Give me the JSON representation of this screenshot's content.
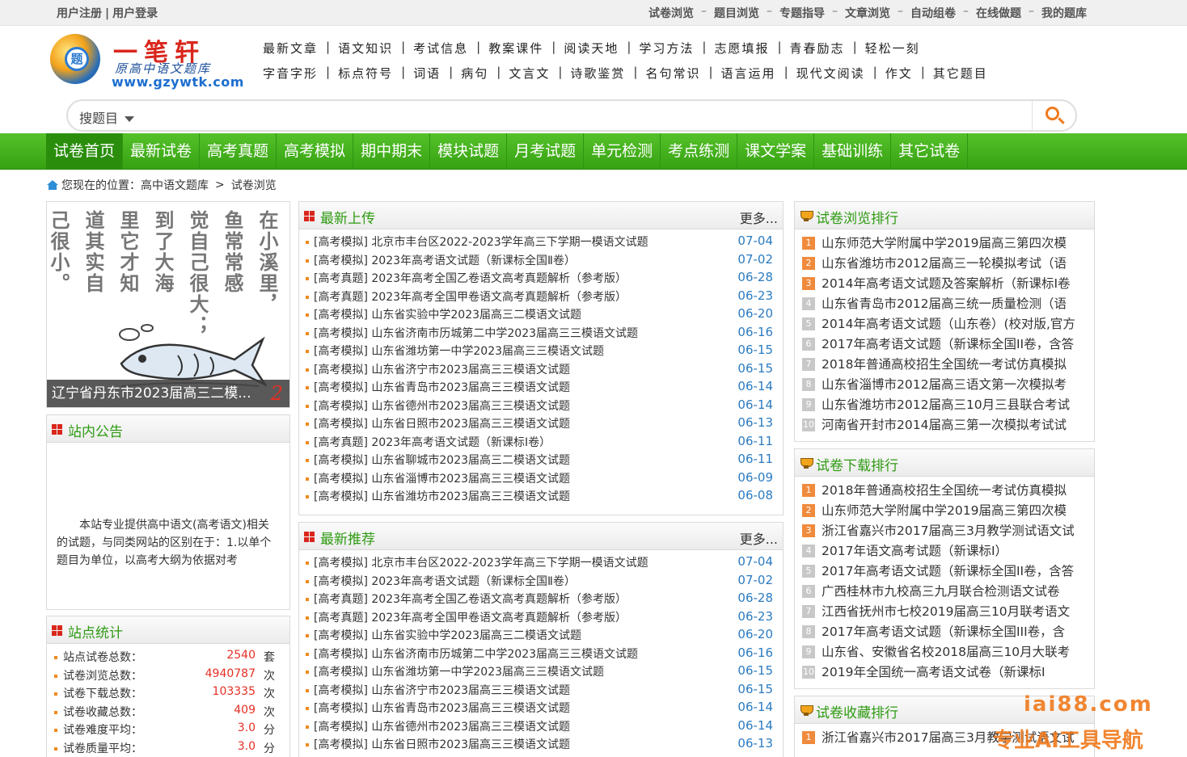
{
  "topbar": {
    "left": [
      "用户注册",
      "用户登录"
    ],
    "left_sep": "|",
    "right": [
      "试卷浏览",
      "题目浏览",
      "专题指导",
      "文章浏览",
      "自动组卷",
      "在线做题",
      "我的题库"
    ],
    "right_sep": "–"
  },
  "logo": {
    "brand": "一笔轩",
    "subtitle": "原高中语文题库",
    "url": "www.gzywtk.com",
    "badge": "题"
  },
  "categories": {
    "row1": [
      "最新文章",
      "语文知识",
      "考试信息",
      "教案课件",
      "阅读天地",
      "学习方法",
      "志愿填报",
      "青春励志",
      "轻松一刻"
    ],
    "row2": [
      "字音字形",
      "标点符号",
      "词语",
      "病句",
      "文言文",
      "诗歌鉴赏",
      "名句常识",
      "语言运用",
      "现代文阅读",
      "作文",
      "其它题目"
    ],
    "sep": "|"
  },
  "search": {
    "scope": "搜题目",
    "value": ""
  },
  "nav": [
    "试卷首页",
    "最新试卷",
    "高考真题",
    "高考模拟",
    "期中期末",
    "模块试题",
    "月考试题",
    "单元检测",
    "考点练测",
    "课文学案",
    "基础训练",
    "其它试卷"
  ],
  "breadcrumb": {
    "prefix": "您现在的位置：",
    "path": [
      "高中语文题库",
      "试卷浏览"
    ],
    "sep": ">"
  },
  "featured": {
    "poem_columns": [
      "在小溪里，",
      "鱼常常感",
      "觉自己很大；",
      "到了大海",
      "里它才知",
      "道其实自",
      "己很小。"
    ],
    "caption": "辽宁省丹东市2023届高三二模...",
    "slide_number": "2"
  },
  "notice": {
    "title": "站内公告",
    "text": "本站专业提供高中语文(高考语文)相关的试题，与同类网站的区别在于：1.以单个题目为单位，以高考大纲为依据对考"
  },
  "stats": {
    "title": "站点统计",
    "rows": [
      {
        "label": "站点试卷总数：",
        "value": "2540",
        "unit": "套"
      },
      {
        "label": "试卷浏览总数：",
        "value": "4940787",
        "unit": "次"
      },
      {
        "label": "试卷下载总数：",
        "value": "103335",
        "unit": "次"
      },
      {
        "label": "试卷收藏总数：",
        "value": "409",
        "unit": "次"
      },
      {
        "label": "试卷难度平均：",
        "value": "3.0",
        "unit": "分"
      },
      {
        "label": "试卷质量平均：",
        "value": "3.0",
        "unit": "分"
      }
    ]
  },
  "latest": {
    "title": "最新上传",
    "more": "更多...",
    "items": [
      {
        "text": "[高考模拟] 北京市丰台区2022-2023学年高三下学期一模语文试题",
        "date": "07-04"
      },
      {
        "text": "[高考模拟] 2023年高考语文试题（新课标全国Ⅱ卷）",
        "date": "07-02"
      },
      {
        "text": "[高考真题] 2023年高考全国乙卷语文高考真题解析（参考版）",
        "date": "06-28"
      },
      {
        "text": "[高考真题] 2023年高考全国甲卷语文高考真题解析（参考版）",
        "date": "06-23"
      },
      {
        "text": "[高考模拟] 山东省实验中学2023届高三二模语文试题",
        "date": "06-20"
      },
      {
        "text": "[高考模拟] 山东省济南市历城第二中学2023届高三三模语文试题",
        "date": "06-16"
      },
      {
        "text": "[高考模拟] 山东省潍坊第一中学2023届高三三模语文试题",
        "date": "06-15"
      },
      {
        "text": "[高考模拟] 山东省济宁市2023届高三三模语文试题",
        "date": "06-15"
      },
      {
        "text": "[高考模拟] 山东省青岛市2023届高三三模语文试题",
        "date": "06-14"
      },
      {
        "text": "[高考模拟] 山东省德州市2023届高三三模语文试题",
        "date": "06-14"
      },
      {
        "text": "[高考模拟] 山东省日照市2023届高三三模语文试题",
        "date": "06-13"
      },
      {
        "text": "[高考真题] 2023年高考语文试题（新课标Ⅰ卷）",
        "date": "06-11"
      },
      {
        "text": "[高考模拟] 山东省聊城市2023届高三二模语文试题",
        "date": "06-11"
      },
      {
        "text": "[高考模拟] 山东省淄博市2023届高三三模语文试题",
        "date": "06-09"
      },
      {
        "text": "[高考模拟] 山东省潍坊市2023届高三三模语文试题",
        "date": "06-08"
      }
    ]
  },
  "recommend": {
    "title": "最新推荐",
    "more": "更多...",
    "items": [
      {
        "text": "[高考模拟] 北京市丰台区2022-2023学年高三下学期一模语文试题",
        "date": "07-04"
      },
      {
        "text": "[高考模拟] 2023年高考语文试题（新课标全国Ⅱ卷）",
        "date": "07-02"
      },
      {
        "text": "[高考真题] 2023年高考全国乙卷语文高考真题解析（参考版）",
        "date": "06-28"
      },
      {
        "text": "[高考真题] 2023年高考全国甲卷语文高考真题解析（参考版）",
        "date": "06-23"
      },
      {
        "text": "[高考模拟] 山东省实验中学2023届高三二模语文试题",
        "date": "06-20"
      },
      {
        "text": "[高考模拟] 山东省济南市历城第二中学2023届高三三模语文试题",
        "date": "06-16"
      },
      {
        "text": "[高考模拟] 山东省潍坊第一中学2023届高三三模语文试题",
        "date": "06-15"
      },
      {
        "text": "[高考模拟] 山东省济宁市2023届高三三模语文试题",
        "date": "06-15"
      },
      {
        "text": "[高考模拟] 山东省青岛市2023届高三三模语文试题",
        "date": "06-14"
      },
      {
        "text": "[高考模拟] 山东省德州市2023届高三三模语文试题",
        "date": "06-14"
      },
      {
        "text": "[高考模拟] 山东省日照市2023届高三三模语文试题",
        "date": "06-13"
      }
    ]
  },
  "rank_browse": {
    "title": "试卷浏览排行",
    "items": [
      "山东师范大学附属中学2019届高三第四次模",
      "山东省潍坊市2012届高三一轮模拟考试（语",
      "2014年高考语文试题及答案解析（新课标Ⅰ卷",
      "山东省青岛市2012届高三统一质量检测（语",
      "2014年高考语文试题（山东卷）(校对版,官方",
      "2017年高考语文试题（新课标全国II卷，含答",
      "2018年普通高校招生全国统一考试仿真模拟",
      "山东省淄博市2012届高三语文第一次模拟考",
      "山东省潍坊市2012届高三10月三县联合考试",
      "河南省开封市2014届高三第一次模拟考试试"
    ]
  },
  "rank_download": {
    "title": "试卷下载排行",
    "items": [
      "2018年普通高校招生全国统一考试仿真模拟",
      "山东师范大学附属中学2019届高三第四次模",
      "浙江省嘉兴市2017届高三3月教学测试语文试",
      "2017年语文高考试题（新课标Ⅰ）",
      "2017年高考语文试题（新课标全国II卷，含答",
      "广西桂林市九校高三九月联合检测语文试卷",
      "江西省抚州市七校2019届高三10月联考语文",
      "2017年高考语文试题（新课标全国III卷，含",
      "山东省、安徽省名校2018届高三10月大联考",
      "2019年全国统一高考语文试卷（新课标Ⅰ"
    ]
  },
  "rank_collect": {
    "title": "试卷收藏排行",
    "items": [
      "浙江省嘉兴市2017届高三3月教学测试语文试"
    ]
  },
  "watermark": {
    "line1": "iai88.com",
    "line2": "专业AI工具导航"
  }
}
